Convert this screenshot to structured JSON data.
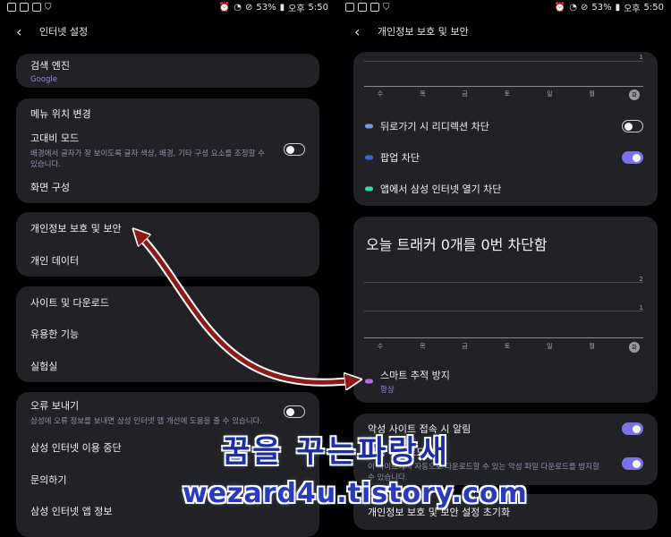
{
  "status_bar": {
    "battery": "53%",
    "ampm": "오후",
    "time": "5:50"
  },
  "left": {
    "title": "인터넷 설정",
    "search_engine": {
      "label": "검색 엔진",
      "value": "Google"
    },
    "menu_position": "메뉴 위치 변경",
    "high_contrast": {
      "label": "고대비 모드",
      "description": "배경에서 글자가 잘 보이도록 글자 색상, 배경, 기타 구성 요소를 조정할 수 있습니다.",
      "enabled": false
    },
    "layout": "화면 구성",
    "privacy": "개인정보 보호 및 보안",
    "personal_data": "개인 데이터",
    "sites_downloads": "사이트 및 다운로드",
    "useful_features": "유용한 기능",
    "labs": "실험실",
    "error_report": {
      "label": "오류 보내기",
      "description": "삼성에 오류 정보를 보내면 삼성 인터넷 앱 개선에 도움을 줄 수 있습니다.",
      "enabled": false
    },
    "stop_using": "삼성 인터넷 이용 중단",
    "contact": "문의하기",
    "app_info": "삼성 인터넷 앱 정보"
  },
  "right": {
    "title": "개인정보 보호 및 보안",
    "chart1": {
      "top_value": "1",
      "days": [
        "수",
        "목",
        "금",
        "토",
        "일",
        "월",
        "화"
      ]
    },
    "redirect_block": {
      "label": "뒤로가기 시 리디렉션 차단",
      "enabled": false,
      "color": "#6f9be8"
    },
    "popup_block": {
      "label": "팝업 차단",
      "enabled": true,
      "color": "#3c63d6"
    },
    "app_open_block": {
      "label": "앱에서 삼성 인터넷 열기 차단",
      "color": "#3fd6ad"
    },
    "tracker_title": "오늘 트래커 0개를 0번 차단함",
    "chart2": {
      "top_value": "2",
      "mid_value": "1",
      "days": [
        "수",
        "목",
        "금",
        "토",
        "일",
        "월",
        "화"
      ]
    },
    "smart_tracking": {
      "label": "스마트 추적 방지",
      "value": "항상",
      "color": "#b86ce0"
    },
    "malicious_alert": {
      "label": "악성 사이트 접속 시 알림",
      "enabled": true
    },
    "auto_download_block": {
      "label": "자동 다운로드 차단",
      "description": "이 사이트에서 자동으로 다운로드할 수 있는 악성 파일 다운로드를 방지할 수 있습니다.",
      "enabled": true
    },
    "settings_init": "개인정보 보호 및 보안 설정 초기화"
  },
  "watermark": {
    "line1": "꿈을 꾸는파랑새",
    "line2": "wezard4u.tistory.com"
  },
  "annotation": {
    "color": "#8b1a1a",
    "meaning": "links 개인정보 보호 및 보안 to 스마트 추적 방지"
  }
}
